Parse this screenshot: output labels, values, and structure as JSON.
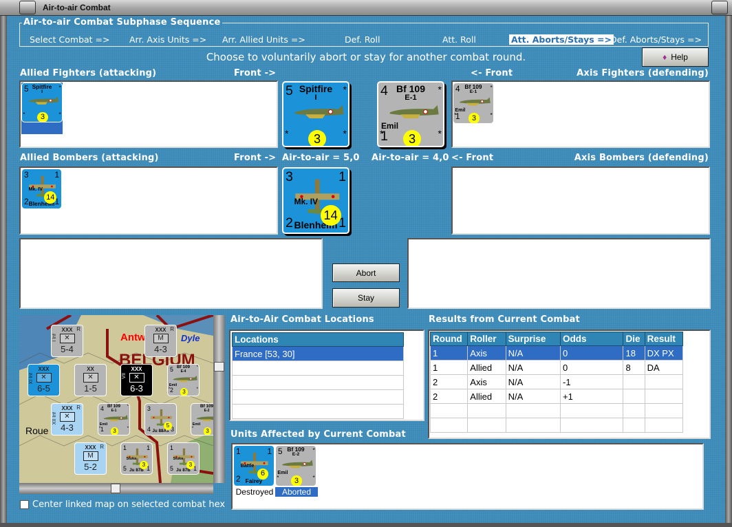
{
  "window": {
    "title": "Air-to-air Combat"
  },
  "sequence": {
    "title": "Air-to-air Combat Subphase Sequence",
    "steps": [
      "Select Combat =>",
      "Arr. Axis Units =>",
      "Arr. Allied Units  =>",
      "Def. Roll",
      "Att. Roll",
      "Att. Aborts/Stays =>",
      "Def. Aborts/Stays =>"
    ],
    "active_index": 5
  },
  "instruction": "Choose to voluntarily abort or stay for another combat round.",
  "help_label": "Help",
  "labels": {
    "allied_fighters": "Allied Fighters (attacking)",
    "front_right": "Front ->",
    "front_left": "<- Front",
    "axis_fighters": "Axis Fighters (defending)",
    "allied_bombers": "Allied Bombers (attacking)",
    "axis_bombers": "Axis Bombers (defending)",
    "allied_a2a": "Air-to-air = 5,0",
    "axis_a2a": "Air-to-air = 4,0"
  },
  "units": {
    "spitfire": {
      "tl": "5",
      "name": "Spitfire",
      "sub": "I",
      "circle": "3",
      "color": "#1c93d8"
    },
    "bf109e1": {
      "tl": "4",
      "name": "Bf 109",
      "sub": "E-1",
      "label": "Emil",
      "bl": "1",
      "circle": "3",
      "color": "#b4b4b4"
    },
    "blenheim": {
      "tl": "3",
      "tr": "1",
      "label": "Mk. IV",
      "name": "Blenheim",
      "bl": "2",
      "br": "1",
      "circle": "14",
      "color": "#1c93d8"
    },
    "battle": {
      "tl": "1",
      "tr": "1",
      "label": "Battle",
      "name": "Fairey",
      "bl": "2",
      "circle": "6",
      "color": "#1c93d8"
    },
    "bf109e2": {
      "tl": "5",
      "name": "Bf 109",
      "sub": "E-2",
      "label": "Emil",
      "circle": "3",
      "color": "#b4b4b4"
    }
  },
  "buttons": {
    "abort": "Abort",
    "stay": "Stay"
  },
  "locations": {
    "title": "Air-to-Air Combat Locations",
    "header": "Locations",
    "rows": [
      "France [53, 30]"
    ]
  },
  "results": {
    "title": "Results from Current Combat",
    "columns": [
      "Round",
      "Roller",
      "Surprise",
      "Odds",
      "Die",
      "Result"
    ],
    "rows": [
      [
        "1",
        "Axis",
        "N/A",
        "0",
        "18",
        "DX PX"
      ],
      [
        "1",
        "Allied",
        "N/A",
        "0",
        "8",
        "DA"
      ],
      [
        "2",
        "Axis",
        "N/A",
        "-1",
        "",
        ""
      ],
      [
        "2",
        "Allied",
        "N/A",
        "+1",
        "",
        ""
      ]
    ]
  },
  "affected": {
    "title": "Units Affected by Current Combat",
    "items": [
      {
        "unit": "battle",
        "status": "Destroyed"
      },
      {
        "unit": "bf109e2",
        "status": "Aborted"
      }
    ]
  },
  "map": {
    "place_names": [
      "Antw",
      "Dyle",
      "BELGIUM",
      "Roue"
    ],
    "ground": [
      {
        "type": "XXX",
        "side": "I Inf",
        "r": "R",
        "val": "5-4",
        "color": "#b4b4b4",
        "sym": "X"
      },
      {
        "type": "XXX",
        "side": "",
        "r": "R",
        "val": "4-3",
        "color": "#b4b4b4",
        "sym": "M"
      },
      {
        "type": "XXX",
        "side": "XI Inf",
        "r": "",
        "val": "6-5",
        "color": "#1c93d8",
        "sym": "X"
      },
      {
        "type": "XX",
        "side": "",
        "r": "",
        "val": "1-5",
        "color": "#b4b4b4",
        "sym": "X"
      },
      {
        "type": "XXX",
        "side": "VII",
        "r": "",
        "val": "6-3",
        "color": "#000000",
        "sym": "X"
      },
      {
        "type": "XXX",
        "side": "XII Inf",
        "r": "R",
        "val": "4-3",
        "color": "#a8d4f4",
        "sym": "X"
      },
      {
        "type": "XXX",
        "side": "",
        "r": "R",
        "val": "5-2",
        "color": "#a8d4f4",
        "sym": "M"
      }
    ],
    "air": [
      {
        "tl": "5",
        "name": "Bf 109",
        "sub": "E-4",
        "label": "Emil",
        "bl": "2",
        "circle": "3"
      },
      {
        "tl": "4",
        "name": "Bf 109",
        "sub": "E-1",
        "label": "Emil",
        "bl": "1",
        "circle": "3"
      },
      {
        "tl": "3",
        "name": "Ju 88A1",
        "bl": "4",
        "br": "3",
        "circle": "5"
      },
      {
        "name": "Bf 109",
        "sub": "E-2",
        "label": "Emil",
        "circle": "3"
      },
      {
        "tl": "1",
        "tr": "1",
        "label": "Stuka",
        "name": "Ju 87B",
        "bl": "5",
        "br": "1",
        "circle": "3"
      },
      {
        "tl": "1",
        "label": "Stuka",
        "name": "Ju 87B",
        "bl": "5",
        "br": "1",
        "circle": "3"
      }
    ]
  },
  "checkbox": {
    "label": "Center linked map on selected combat hex",
    "checked": false
  }
}
